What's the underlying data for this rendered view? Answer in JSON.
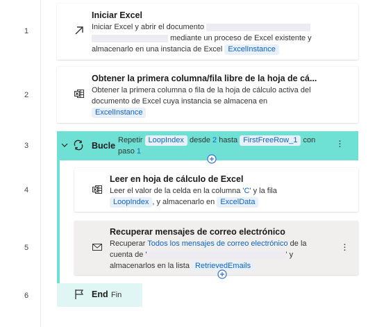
{
  "line_numbers": [
    "1",
    "2",
    "3",
    "4",
    "5",
    "6"
  ],
  "steps": {
    "s1": {
      "title": "Iniciar Excel",
      "text1": "Iniciar Excel y abrir el documento",
      "text2": "mediante un proceso de Excel existente y",
      "text3": "almacenarlo en una instancia de Excel",
      "var": "ExcelInstance",
      "icon": "launch-arrow-icon"
    },
    "s2": {
      "title": "Obtener la primera columna/fila libre de la hoja de cá...",
      "text1": "Obtener la primera columna o fila de la hoja de cálculo activa del",
      "text2": "documento de Excel cuya instancia se almacena en",
      "var": "ExcelInstance",
      "icon": "excel-sheet-icon"
    },
    "s3": {
      "title": "Bucle",
      "t_repeat": "Repetir",
      "var1": "LoopIndex",
      "t_from": "desde",
      "from_val": "2",
      "t_to": "hasta",
      "var2": "FirstFreeRow_1",
      "t_with": "con",
      "t_step": "paso",
      "step_val": "1",
      "icon": "loop-icon"
    },
    "s4": {
      "title": "Leer en hoja de cálculo de Excel",
      "text1": "Leer el valor de la celda en la columna",
      "col_val": "'C'",
      "text1b": "y la fila",
      "var1": ",",
      "var_loop": "LoopIndex",
      "text2": ", y almacenarlo en",
      "var2": "ExcelData",
      "icon": "excel-sheet-icon"
    },
    "s5": {
      "title": "Recuperar mensajes de correo electrónico",
      "text1": "Recuperar",
      "link1": "Todos los mensajes de correo electrónico",
      "text1b": "de la",
      "text2": "cuenta de '",
      "text2b": "' y",
      "text3": "almacenarlos en la lista",
      "var": "RetrievedEmails",
      "icon": "mail-icon"
    },
    "s6": {
      "title": "End",
      "sub": "Fin",
      "icon": "flag-icon"
    }
  }
}
